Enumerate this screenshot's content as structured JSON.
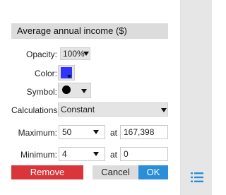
{
  "panel": {
    "title": "Average annual income ($)",
    "opacity": {
      "label": "Opacity:",
      "value": "100%"
    },
    "color": {
      "label": "Color:",
      "value": "#3333ff"
    },
    "symbol": {
      "label": "Symbol:",
      "value": "circle"
    },
    "calculations": {
      "label": "Calculations:",
      "value": "Constant"
    },
    "maximum": {
      "label": "Maximum:",
      "value": "50",
      "at_label": "at",
      "at_value": "167,398"
    },
    "minimum": {
      "label": "Minimum:",
      "value": "4",
      "at_label": "at",
      "at_value": "0"
    },
    "buttons": {
      "remove": "Remove",
      "cancel": "Cancel",
      "ok": "OK"
    }
  },
  "sidebar": {
    "icon": "list-icon"
  },
  "colors": {
    "remove": "#d9353a",
    "ok": "#2a8fd8",
    "cancel": "#dcdcdc",
    "title_bar": "#dcdcdc"
  }
}
